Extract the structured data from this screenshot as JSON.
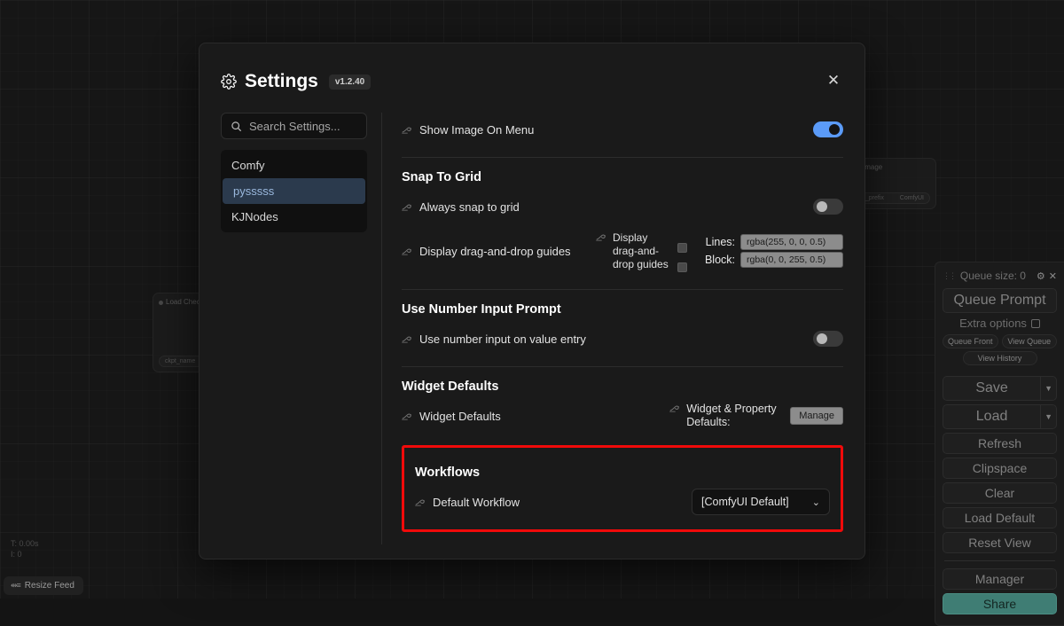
{
  "canvas": {
    "nodes": [
      {
        "title": "Load Chec",
        "widget_label": "ckpt_name",
        "widget_value": ""
      },
      {
        "title": "Image",
        "widget_label": "e_prefix",
        "widget_value": "ComfyUI"
      }
    ],
    "perf": {
      "line1": "T: 0.00s",
      "line2": "I: 0"
    },
    "resize_feed": {
      "label": "Resize Feed",
      "icon": "resize-icon"
    }
  },
  "comfy_menu": {
    "queue_size_label": "Queue size: 0",
    "drag_icon": "drag-handle-icon",
    "gear_icon": "gear-icon",
    "close_icon": "close-icon",
    "queue_prompt": "Queue Prompt",
    "extra_options": "Extra options",
    "queue_front": "Queue Front",
    "view_queue": "View Queue",
    "view_history": "View History",
    "save": "Save",
    "load": "Load",
    "refresh": "Refresh",
    "clipspace": "Clipspace",
    "clear": "Clear",
    "load_default": "Load Default",
    "reset_view": "Reset View",
    "manager": "Manager",
    "share": "Share",
    "share_color": "#3f7d74"
  },
  "dialog": {
    "title": "Settings",
    "version": "v1.2.40",
    "gear_icon": "gear-icon",
    "close_icon": "close-icon",
    "search": {
      "placeholder": "Search Settings...",
      "value": "",
      "icon": "search-icon"
    },
    "categories": [
      {
        "label": "Comfy",
        "active": false
      },
      {
        "label": "pysssss",
        "active": true
      },
      {
        "label": "KJNodes",
        "active": false
      }
    ],
    "accent_active": "#2b3a4d",
    "accent_toggle_on": "#5b9bf8",
    "highlight_color": "#f00a0a",
    "settings": {
      "show_image_on_menu": {
        "label": "Show Image On Menu",
        "toggle": "on",
        "icon": "pysssss-snake-icon"
      },
      "snap_section": "Snap To Grid",
      "always_snap": {
        "label": "Always snap to grid",
        "toggle": "off",
        "icon": "pysssss-snake-icon"
      },
      "drag_guides": {
        "label": "Display drag-and-drop guides",
        "icon": "pysssss-snake-icon",
        "sub_label": "Display drag-and-drop guides",
        "lines_label": "Lines:",
        "lines_value": "rgba(255, 0, 0, 0.5)",
        "block_label": "Block:",
        "block_value": "rgba(0, 0, 255, 0.5)"
      },
      "number_section": "Use Number Input Prompt",
      "number_input": {
        "label": "Use number input on value entry",
        "toggle": "off",
        "icon": "pysssss-snake-icon"
      },
      "widget_section": "Widget Defaults",
      "widget_defaults": {
        "label": "Widget Defaults",
        "icon": "pysssss-snake-icon",
        "sub_label": "Widget & Property Defaults:",
        "button": "Manage"
      },
      "workflows_section": "Workflows",
      "default_workflow": {
        "label": "Default Workflow",
        "icon": "pysssss-snake-icon",
        "value": "[ComfyUI Default]",
        "chevron": "chevron-down-icon"
      }
    }
  }
}
